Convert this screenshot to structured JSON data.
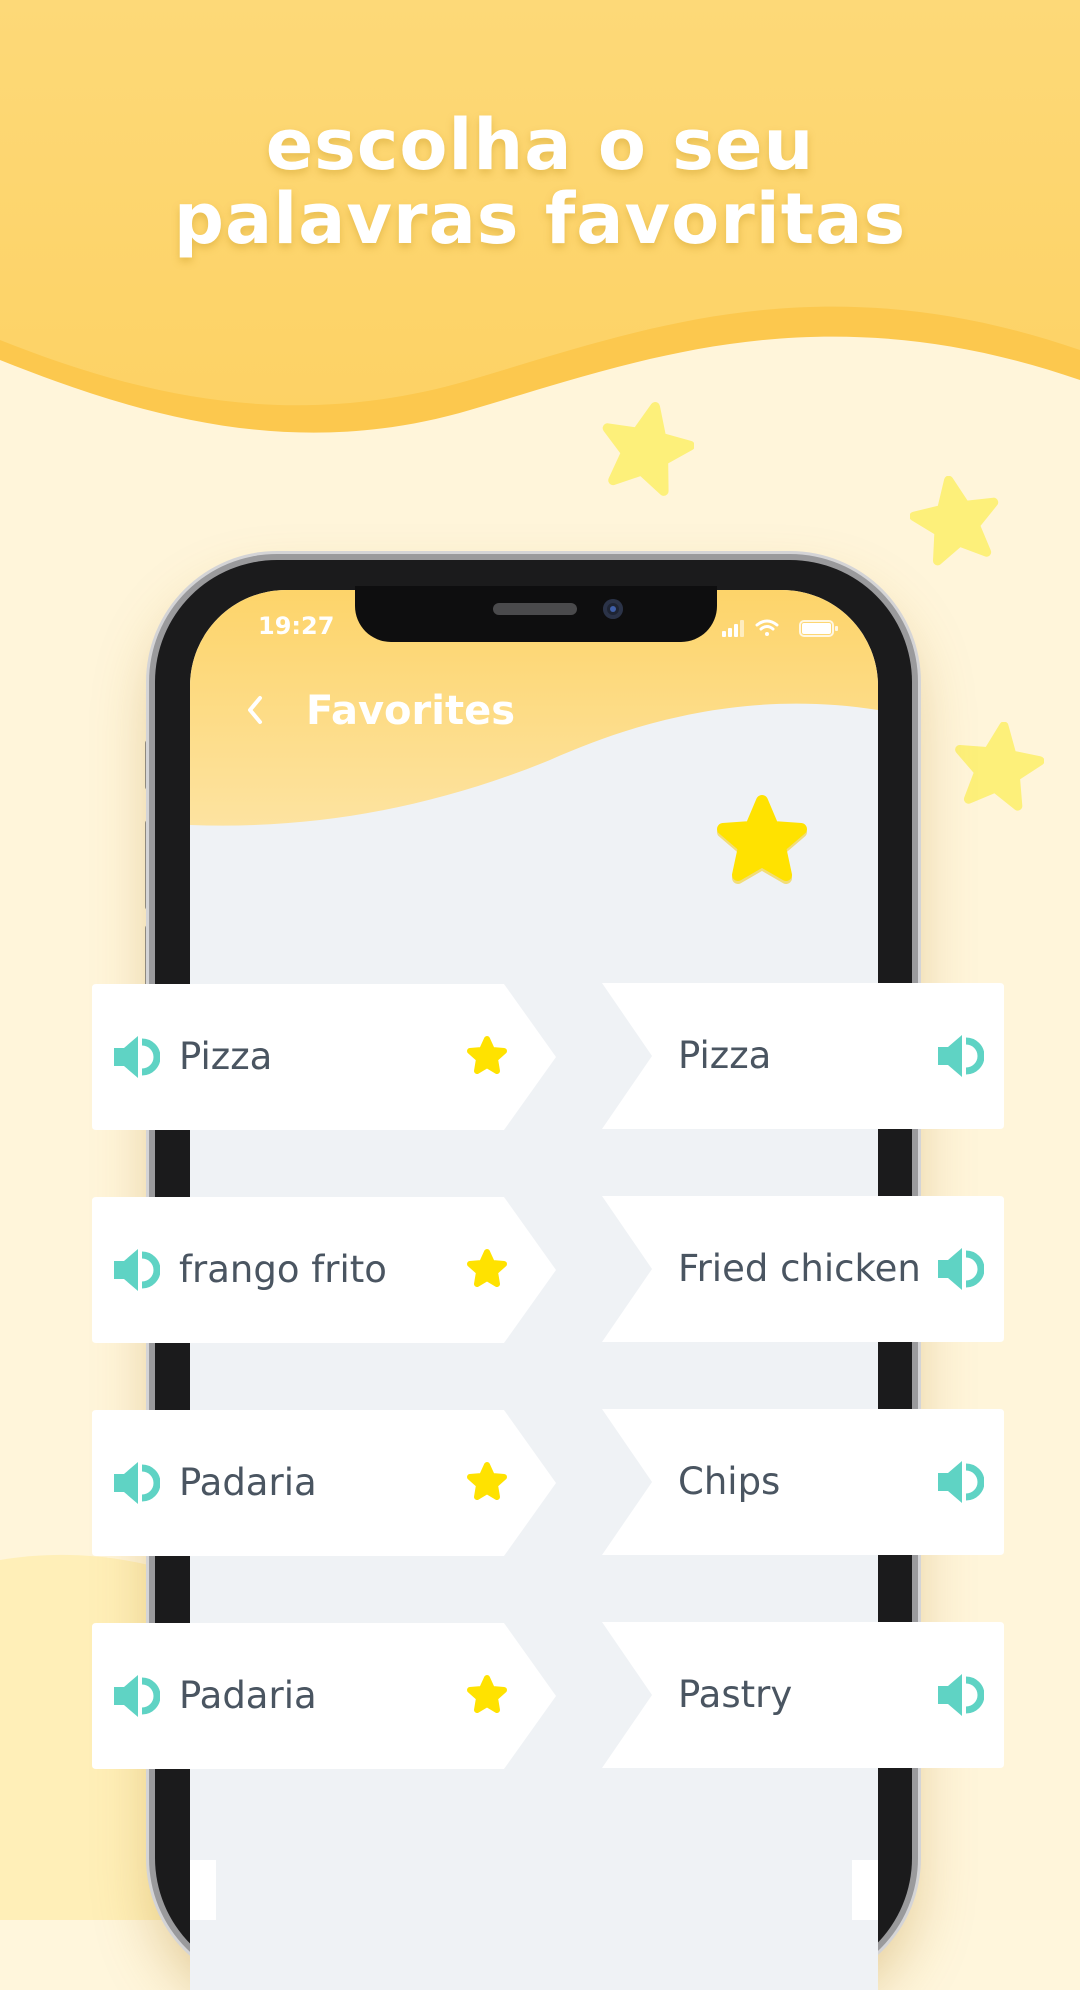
{
  "headline": {
    "line1": "escolha o seu",
    "line2": "palavras favoritas"
  },
  "status_bar": {
    "time": "19:27",
    "icons": [
      "signal-icon",
      "wifi-icon",
      "battery-icon"
    ]
  },
  "header": {
    "back_icon": "chevron-left-icon",
    "title": "Favorites",
    "badge_icon": "star-icon"
  },
  "rows": [
    {
      "source": "Pizza",
      "translation": "Pizza",
      "favorited": true
    },
    {
      "source": "frango frito",
      "translation": "Fried chicken",
      "favorited": true
    },
    {
      "source": "Padaria",
      "translation": "Chips",
      "favorited": true
    },
    {
      "source": "Padaria",
      "translation": "Pastry",
      "favorited": true
    }
  ],
  "row_icons": {
    "audio": "speaker-icon",
    "favorite": "star-icon"
  },
  "colors": {
    "accent_yellow": "#fdd56a",
    "star_yellow": "#ffe200",
    "audio_teal": "#5fd3c4",
    "word_text": "#4a5561",
    "screen_bg": "#eff2f5"
  }
}
